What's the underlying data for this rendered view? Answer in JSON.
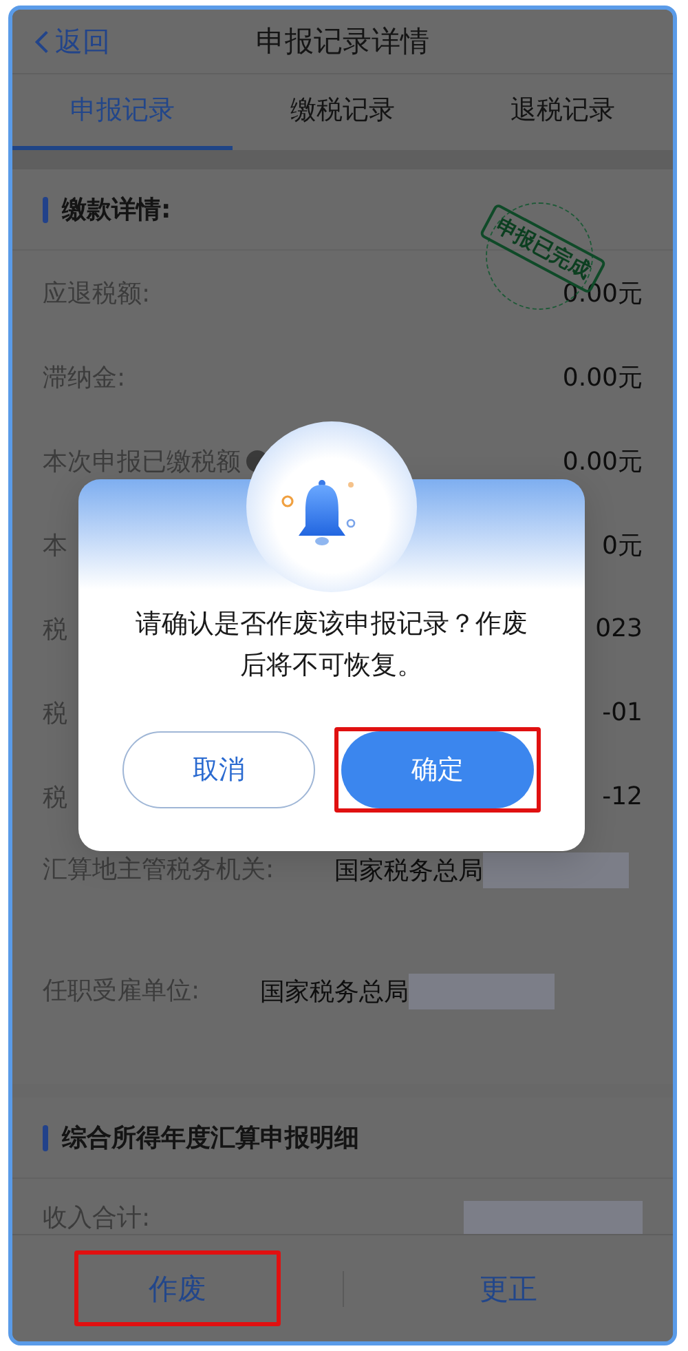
{
  "header": {
    "back": "返回",
    "title": "申报记录详情"
  },
  "tabs": [
    {
      "label": "申报记录",
      "selected": true
    },
    {
      "label": "缴税记录",
      "selected": false
    },
    {
      "label": "退税记录",
      "selected": false
    }
  ],
  "sections": [
    {
      "heading": "缴款详情:",
      "stamp": "申报已完成",
      "rows": [
        {
          "label": "应退税额:",
          "value": "0.00元",
          "redacted": false
        },
        {
          "label": "滞纳金:",
          "value": "0.00元",
          "redacted": false
        },
        {
          "label": "本次申报已缴税额",
          "value": "0.00元",
          "redacted": false,
          "info": true
        },
        {
          "label": "本",
          "value": "0元",
          "redacted": false
        },
        {
          "label": "税",
          "value": "023",
          "redacted": false
        },
        {
          "label": "税",
          "value": "-01",
          "redacted": false
        },
        {
          "label": "税",
          "value": "-12",
          "redacted": false
        },
        {
          "label": "汇算地主管税务机关:",
          "value": "国家税务总局",
          "redacted": true
        },
        {
          "label": "任职受雇单位:",
          "value": "国家税务总局",
          "redacted": true
        }
      ]
    },
    {
      "heading": "综合所得年度汇算申报明细",
      "rows": [
        {
          "label": "收入合计:",
          "redacted": true
        }
      ]
    }
  ],
  "dialog": {
    "message": "请确认是否作废该申报记录？作废后将不可恢复。",
    "buttons": [
      {
        "label": "取消",
        "kind": "secondary",
        "highlighted": false
      },
      {
        "label": "确定",
        "kind": "primary",
        "highlighted": true
      }
    ]
  },
  "bottom_bar": [
    {
      "label": "作废",
      "highlighted": true
    },
    {
      "label": "更正",
      "highlighted": false
    }
  ]
}
